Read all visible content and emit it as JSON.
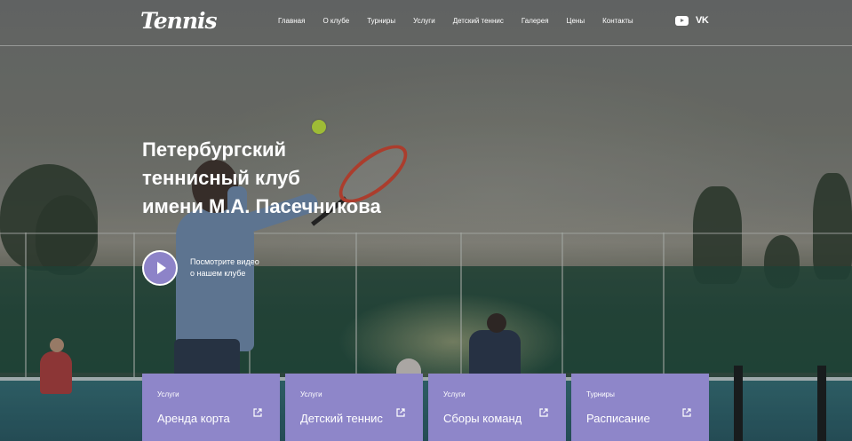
{
  "header": {
    "logo": "Tennis",
    "nav": [
      "Главная",
      "О клубе",
      "Турниры",
      "Услуги",
      "Детский теннис",
      "Галерея",
      "Цены",
      "Контакты"
    ],
    "social": {
      "youtube_icon": "youtube-icon",
      "vk_label": "VK"
    }
  },
  "hero": {
    "title_lines": [
      "Петербургский",
      "теннисный клуб",
      "имени М.А. Пасечникова"
    ],
    "video_text_lines": [
      "Посмотрите видео",
      "о нашем клубе"
    ]
  },
  "cards": [
    {
      "category": "Услуги",
      "title": "Аренда корта"
    },
    {
      "category": "Услуги",
      "title": "Детский теннис"
    },
    {
      "category": "Услуги",
      "title": "Сборы команд"
    },
    {
      "category": "Турниры",
      "title": "Расписание"
    }
  ],
  "colors": {
    "accent": "#8e86c9",
    "text": "#ffffff"
  }
}
